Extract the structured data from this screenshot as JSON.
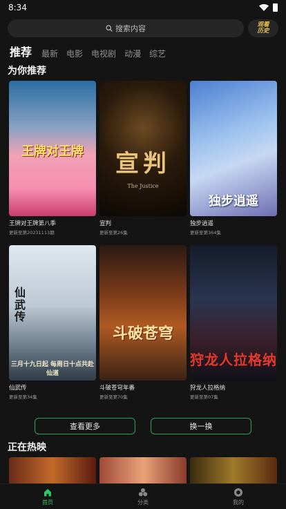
{
  "status_bar": {
    "time": "8:34"
  },
  "search": {
    "placeholder": "搜索内容",
    "history_label_1": "观看",
    "history_label_2": "历史"
  },
  "tabs": [
    {
      "label": "推荐",
      "active": true
    },
    {
      "label": "最新"
    },
    {
      "label": "电影"
    },
    {
      "label": "电视剧"
    },
    {
      "label": "动漫"
    },
    {
      "label": "综艺"
    }
  ],
  "section_recommend": {
    "title": "为你推荐"
  },
  "cards": [
    {
      "title": "王牌对王牌第八季",
      "sub": "更新至第20231113期",
      "poster_text": "王牌对王牌"
    },
    {
      "title": "宣判",
      "sub": "更新至第26集",
      "poster_text": "宣判",
      "poster_sub": "The Justice"
    },
    {
      "title": "独步逍遥",
      "sub": "更新至第364集",
      "poster_text": "独步逍遥"
    },
    {
      "title": "仙武传",
      "sub": "更新至第34集",
      "poster_text": "仙武传",
      "poster_sub": "三月十九日起 每周日十点共赴仙道"
    },
    {
      "title": "斗破苍穹年番",
      "sub": "更新至第70集",
      "poster_text": "斗破苍穹"
    },
    {
      "title": "狩龙人拉格纳",
      "sub": "更新至第07集",
      "poster_text": "狩龙人拉格纳"
    }
  ],
  "actions": {
    "more_label": "查看更多",
    "refresh_label": "换一换"
  },
  "section_now": {
    "title": "正在热映"
  },
  "bottom_nav": [
    {
      "label": "首页",
      "icon": "home-icon",
      "active": true
    },
    {
      "label": "分类",
      "icon": "category-icon"
    },
    {
      "label": "我的",
      "icon": "profile-icon"
    }
  ],
  "colors": {
    "accent": "#2fc56a",
    "background": "#141414",
    "history_accent": "#e8c24a"
  }
}
